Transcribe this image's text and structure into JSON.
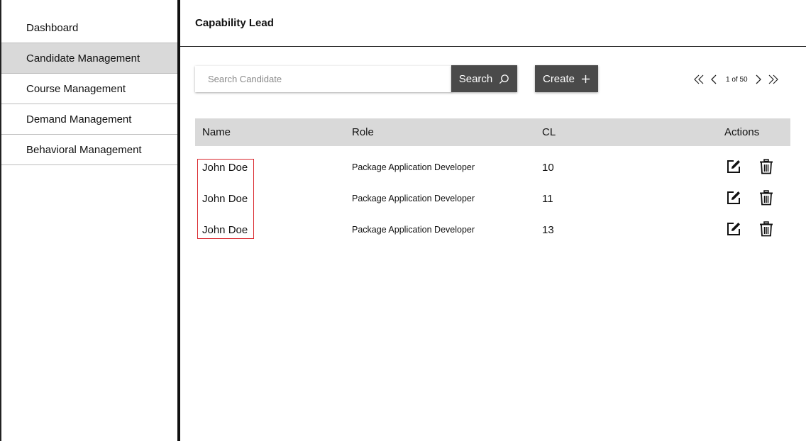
{
  "sidebar": {
    "items": [
      {
        "label": "Dashboard",
        "active": false
      },
      {
        "label": "Candidate Management",
        "active": true
      },
      {
        "label": "Course Management",
        "active": false
      },
      {
        "label": "Demand Management",
        "active": false
      },
      {
        "label": "Behavioral Management",
        "active": false
      }
    ]
  },
  "header": {
    "title": "Capability Lead"
  },
  "toolbar": {
    "search_placeholder": "Search Candidate",
    "search_value": "",
    "search_label": "Search",
    "create_label": "Create",
    "search_icon": "search-icon",
    "create_icon": "plus-icon"
  },
  "pager": {
    "text": "1 of 50",
    "current_page": 1,
    "total_pages": 50
  },
  "table": {
    "columns": [
      "Name",
      "Role",
      "CL",
      "Actions"
    ],
    "rows": [
      {
        "name": "John Doe",
        "role": "Package Application Developer",
        "cl": "10"
      },
      {
        "name": "John Doe",
        "role": "Package Application Developer",
        "cl": "11"
      },
      {
        "name": "John Doe",
        "role": "Package Application Developer",
        "cl": "13"
      }
    ],
    "row_actions": [
      "edit-icon",
      "trash-icon"
    ]
  },
  "colors": {
    "button_bg": "#4a4a4a",
    "active_nav_bg": "#d9d9d9",
    "table_header_bg": "#d9d9d9",
    "highlight_border": "#d9262c"
  }
}
